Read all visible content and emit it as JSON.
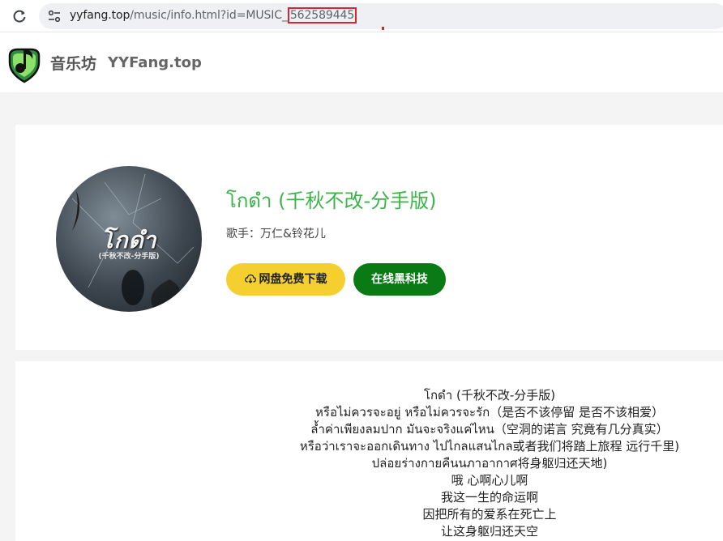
{
  "browser": {
    "url_domain": "yyfang.top",
    "url_path": "/music/info.html?id=MUSIC_",
    "url_id": "562589445"
  },
  "site": {
    "name": "音乐坊",
    "domain": "YYFang.top"
  },
  "song": {
    "title": "โกดำ (千秋不改-分手版)",
    "singer_label": "歌手：",
    "singer": "万仁&铃花儿",
    "cover_title": "โกดำ",
    "cover_subtitle": "(千秋不改-分手版)"
  },
  "buttons": {
    "download": "网盘免费下载",
    "online": "在线黑科技"
  },
  "lyrics": [
    "โกดำ (千秋不改-分手版)",
    "หรือไม่ควรจะอยู่ หรือไม่ควรจะรัก（是否不该停留 是否不该相爱）",
    "ล้ำค่าเพียงลมปาก มันจะจริงแค่ไหน（空洞的诺言 究竟有几分真实）",
    "หรือว่าเราจะออกเดินทาง ไปไกลแสนไกล或者我们将踏上旅程 远行千里)",
    "ปล่อยร่างกายคืนนภาอากาศ将身躯归还天地)",
    "哦 心啊心儿啊",
    "我这一生的命运啊",
    "因把所有的爱系在死亡上",
    "让这身躯归还天空"
  ],
  "colors": {
    "title_green": "#3bb54a",
    "download_yellow": "#f5cf2f",
    "online_green": "#0a7a14",
    "highlight_red": "#d9262c"
  }
}
